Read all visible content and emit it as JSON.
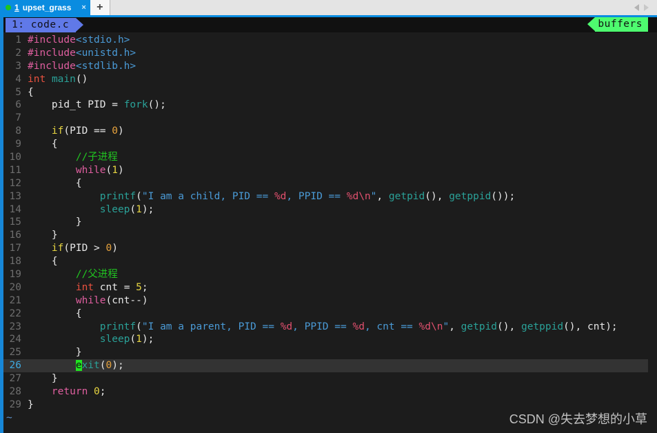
{
  "window": {
    "tab": {
      "index": "1",
      "title": "upset_grass",
      "close_glyph": "×",
      "status_dot_color": "#1ec41e",
      "active_bg": "#0a8ce0"
    },
    "new_tab_glyph": "+",
    "nav_left_icon": "left-arrow-icon",
    "nav_right_icon": "right-arrow-icon"
  },
  "bufferline": {
    "active_buffer": "1: code.c",
    "right_label": "buffers",
    "active_buffer_bg": "#6079e8",
    "right_label_bg": "#4efb6f"
  },
  "editor": {
    "tilde_marker": "~",
    "current_line": 26,
    "cursor_char": "e",
    "lines": [
      {
        "n": "1",
        "text": "#include<stdio.h>"
      },
      {
        "n": "2",
        "text": "#include<unistd.h>"
      },
      {
        "n": "3",
        "text": "#include<stdlib.h>"
      },
      {
        "n": "4",
        "text": "int main()"
      },
      {
        "n": "5",
        "text": "{"
      },
      {
        "n": "6",
        "text": "    pid_t PID = fork();"
      },
      {
        "n": "7",
        "text": ""
      },
      {
        "n": "8",
        "text": "    if(PID == 0)"
      },
      {
        "n": "9",
        "text": "    {"
      },
      {
        "n": "10",
        "text": "        //子进程"
      },
      {
        "n": "11",
        "text": "        while(1)"
      },
      {
        "n": "12",
        "text": "        {"
      },
      {
        "n": "13",
        "text": "            printf(\"I am a child, PID == %d, PPID == %d\\n\", getpid(), getppid());"
      },
      {
        "n": "14",
        "text": "            sleep(1);"
      },
      {
        "n": "15",
        "text": "        }"
      },
      {
        "n": "16",
        "text": "    }"
      },
      {
        "n": "17",
        "text": "    if(PID > 0)"
      },
      {
        "n": "18",
        "text": "    {"
      },
      {
        "n": "19",
        "text": "        //父进程"
      },
      {
        "n": "20",
        "text": "        int cnt = 5;"
      },
      {
        "n": "21",
        "text": "        while(cnt--)"
      },
      {
        "n": "22",
        "text": "        {"
      },
      {
        "n": "23",
        "text": "            printf(\"I am a parent, PID == %d, PPID == %d, cnt == %d\\n\", getpid(), getppid(), cnt);"
      },
      {
        "n": "24",
        "text": "            sleep(1);"
      },
      {
        "n": "25",
        "text": "        }"
      },
      {
        "n": "26",
        "text": "        exit(0);"
      },
      {
        "n": "27",
        "text": "    }"
      },
      {
        "n": "28",
        "text": "    return 0;"
      },
      {
        "n": "29",
        "text": "}"
      }
    ]
  },
  "watermark": {
    "text": "CSDN @失去梦想的小草"
  }
}
